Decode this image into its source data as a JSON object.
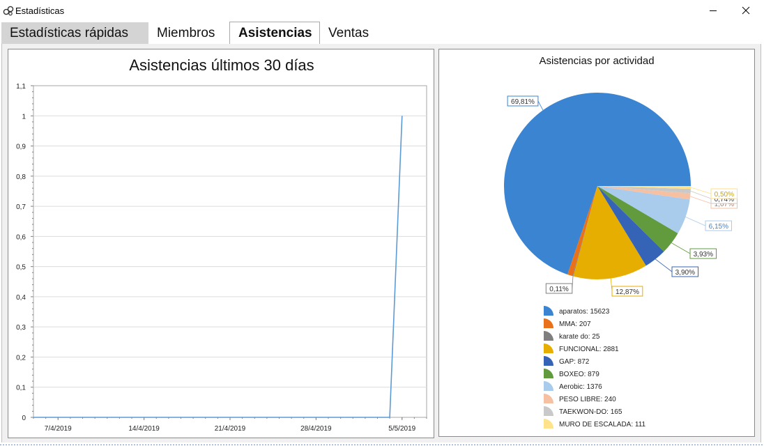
{
  "window": {
    "title": "Estadísticas",
    "icon": "stats-gears-icon",
    "min_icon": "minimize-icon",
    "close_icon": "close-icon"
  },
  "tabs": [
    {
      "label": "Estadísticas rápidas"
    },
    {
      "label": "Miembros"
    },
    {
      "label": "Asistencias",
      "selected": true
    },
    {
      "label": "Ventas"
    }
  ],
  "colors": {
    "line": "#5b9bd5",
    "grid": "#dcdcdc",
    "axis": "#7f7f7f"
  },
  "chart_data": [
    {
      "type": "line",
      "title": "Asistencias últimos 30 días",
      "xlabel": "",
      "ylabel": "",
      "x_tick_labels": [
        "7/4/2019",
        "14/4/2019",
        "21/4/2019",
        "28/4/2019",
        "5/5/2019"
      ],
      "x_start": "5/4/2019",
      "x_end": "7/5/2019",
      "ylim": [
        0,
        1.1
      ],
      "y_tick_labels": [
        "0",
        "0,1",
        "0,2",
        "0,3",
        "0,4",
        "0,5",
        "0,6",
        "0,7",
        "0,8",
        "0,9",
        "1",
        "1,1"
      ],
      "grid": true,
      "series": [
        {
          "color": "#5b9bd5",
          "x": [
            "5/4/2019",
            "6/4/2019",
            "7/4/2019",
            "8/4/2019",
            "9/4/2019",
            "10/4/2019",
            "11/4/2019",
            "12/4/2019",
            "13/4/2019",
            "14/4/2019",
            "15/4/2019",
            "16/4/2019",
            "17/4/2019",
            "18/4/2019",
            "19/4/2019",
            "20/4/2019",
            "21/4/2019",
            "22/4/2019",
            "23/4/2019",
            "24/4/2019",
            "25/4/2019",
            "26/4/2019",
            "27/4/2019",
            "28/4/2019",
            "29/4/2019",
            "30/4/2019",
            "1/5/2019",
            "2/5/2019",
            "3/5/2019",
            "4/5/2019",
            "5/5/2019"
          ],
          "values": [
            0,
            0,
            0,
            0,
            0,
            0,
            0,
            0,
            0,
            0,
            0,
            0,
            0,
            0,
            0,
            0,
            0,
            0,
            0,
            0,
            0,
            0,
            0,
            0,
            0,
            0,
            0,
            0,
            0,
            0,
            1
          ]
        }
      ]
    },
    {
      "type": "pie",
      "title": "Asistencias por actividad",
      "legend_position": "bottom",
      "slices": [
        {
          "label": "aparatos",
          "value": 15623,
          "pct_label": "69,81%",
          "legend": "aparatos: 15623",
          "color": "#3a84d1"
        },
        {
          "label": "MMA",
          "value": 207,
          "pct_label": "",
          "legend": "MMA: 207",
          "color": "#e8711a"
        },
        {
          "label": "karate do",
          "value": 25,
          "pct_label": "0,11%",
          "legend": "karate do: 25",
          "color": "#7f7f7f"
        },
        {
          "label": "FUNCIONAL",
          "value": 2881,
          "pct_label": "12,87%",
          "legend": "FUNCIONAL: 2881",
          "color": "#e6ae00"
        },
        {
          "label": "GAP",
          "value": 872,
          "pct_label": "3,90%",
          "legend": "GAP: 872",
          "color": "#3564b6"
        },
        {
          "label": "BOXEO",
          "value": 879,
          "pct_label": "3,93%",
          "legend": "BOXEO: 879",
          "color": "#619b3e"
        },
        {
          "label": "Aerobic",
          "value": 1376,
          "pct_label": "6,15%",
          "legend": "Aerobic: 1376",
          "color": "#a9cbec"
        },
        {
          "label": "PESO LIBRE",
          "value": 240,
          "pct_label": "1,07%",
          "legend": "PESO LIBRE: 240",
          "color": "#f6c0a3"
        },
        {
          "label": "TAEKWON-DO",
          "value": 165,
          "pct_label": "0,74%",
          "legend": "TAEKWON-DO: 165",
          "color": "#c9c9c9"
        },
        {
          "label": "MURO DE ESCALADA",
          "value": 111,
          "pct_label": "0,50%",
          "legend": "MURO DE ESCALADA: 111",
          "color": "#ffe28a"
        }
      ]
    }
  ]
}
